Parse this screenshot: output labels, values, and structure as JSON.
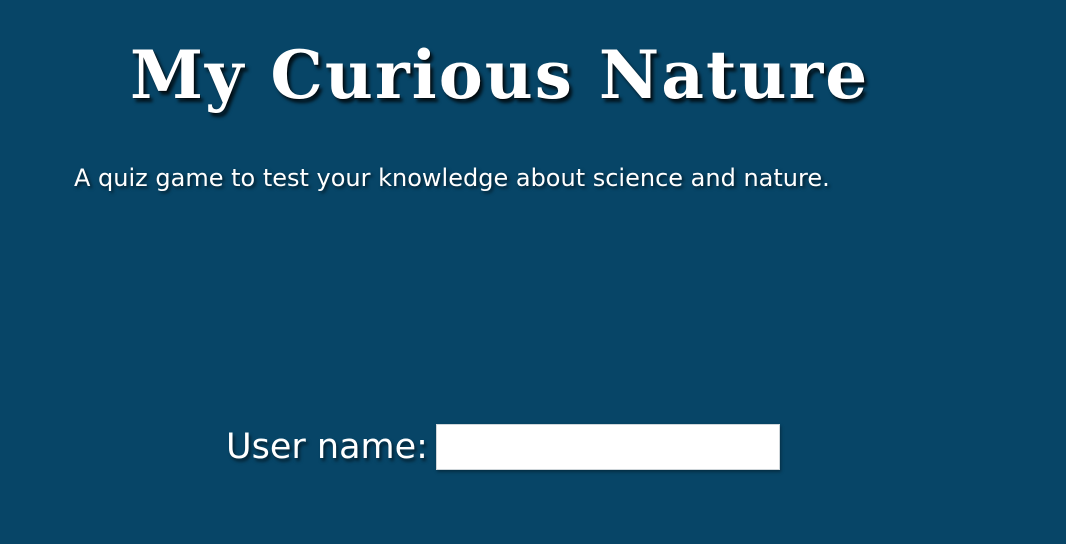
{
  "header": {
    "title": "My Curious Nature",
    "subtitle": "A quiz game to test your knowledge about science and nature."
  },
  "login": {
    "label": "User name:",
    "input_value": "",
    "input_placeholder": ""
  },
  "colors": {
    "background": "#074567",
    "text": "#ffffff",
    "input_background": "#ffffff"
  }
}
